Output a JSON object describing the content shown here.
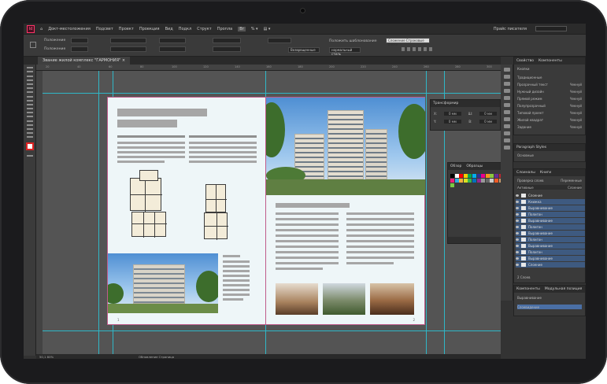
{
  "menubar": {
    "items": [
      "Докт-местоложения",
      "Подсвет",
      "Проект",
      "Проекция",
      "Вид",
      "Подкл",
      "Структ",
      "Пропла"
    ],
    "right_label": "Прайс писателя"
  },
  "control_bar": {
    "labels": [
      "Положение",
      "Положение",
      "Подкл. все",
      "Подкл. все",
      "Выложение",
      "Параметр",
      "Положить шаблонование",
      "Сложение Строковые блоки"
    ],
    "zoom_field": "Возврвщенные",
    "mode_field": "нормальный стиль"
  },
  "document_tab": {
    "title": "Звание жилой комплекс \"ГАРМОНИЯ\""
  },
  "ruler_ticks": [
    "20",
    "30",
    "40",
    "50",
    "60",
    "70",
    "80",
    "90",
    "100",
    "110",
    "120",
    "130",
    "140",
    "150",
    "160",
    "170",
    "180",
    "190",
    "200",
    "210",
    "220",
    "230",
    "240",
    "250",
    "260",
    "270",
    "280",
    "290",
    "300"
  ],
  "spread": {
    "left_page_number": "1",
    "right_page_number": "2"
  },
  "transform_panel": {
    "title": "Трансформир",
    "rows": [
      {
        "label": "X:",
        "value": "0 мм",
        "label2": "Ш:",
        "value2": "0 мм"
      },
      {
        "label": "Y:",
        "value": "0 мм",
        "label2": "В:",
        "value2": "0 мм"
      }
    ]
  },
  "swatches_panel": {
    "tabs": [
      "Обзор",
      "Образцы"
    ],
    "colors": [
      "#000000",
      "#ffffff",
      "#ff0000",
      "#ffcc00",
      "#00a651",
      "#00aeef",
      "#2e3192",
      "#ec008c",
      "#f7941d",
      "#8dc63f",
      "#662d91",
      "#c1272d",
      "#ed1e79",
      "#29abe2",
      "#fbb03b",
      "#d9e021",
      "#39b54a",
      "#0071bc",
      "#93278f",
      "#999999",
      "#666666",
      "#cccccc",
      "#f15a24",
      "#c69c6d",
      "#7ac943"
    ]
  },
  "right_panel": {
    "tabs_top": [
      "Свойство",
      "Компоненты"
    ],
    "section_top": "Кнопки",
    "prop_rows": [
      {
        "label": "Традиционные",
        "value": ""
      },
      {
        "label": "Прозрачный текст",
        "value": "Чекнуй"
      },
      {
        "label": "Нужный дизайн",
        "value": "Чекнуй"
      },
      {
        "label": "Прямой режим",
        "value": "Чекнуй"
      },
      {
        "label": "Полупрозрачный",
        "value": "Чекнуй"
      },
      {
        "label": "Типовой проект",
        "value": "Чекнуй"
      },
      {
        "label": "Жилой квадрат",
        "value": "Чекнуй"
      },
      {
        "label": "Задание",
        "value": "Чекнуй"
      }
    ],
    "paragraph_styles_title": "Paragraph Styles",
    "paragraph_styles_item": "Основные",
    "layers_tabs": [
      "Слоиналы",
      "Книги"
    ],
    "layers_subheader": [
      "Проверка слоев",
      "Переменные"
    ],
    "layers_header": [
      "Активные",
      "Слоение"
    ],
    "layers": [
      {
        "name": "Слоение"
      },
      {
        "name": "Книжка"
      },
      {
        "name": "Выравнивание"
      },
      {
        "name": "Полигон"
      },
      {
        "name": "Выравнивание"
      },
      {
        "name": "Полигон"
      },
      {
        "name": "Выравнивание"
      },
      {
        "name": "Полигон"
      },
      {
        "name": "Выравнивание"
      },
      {
        "name": "Полигон"
      },
      {
        "name": "Выравнивание"
      },
      {
        "name": "Слоение"
      }
    ],
    "layers_count": "2 Слоев",
    "bottom_tabs": [
      "Компоненты",
      "Модульная позиция"
    ],
    "bottom_rows": [
      "Выравнивание",
      "Слоевидение"
    ]
  },
  "status_bar": {
    "zoom": "50,1 80%",
    "page_label": "Обновление Страница"
  },
  "colors": {
    "accent": "#2fb7c7",
    "page_bg": "#eef6f8",
    "pasteboard": "#545454",
    "ui_dark": "#323232"
  }
}
